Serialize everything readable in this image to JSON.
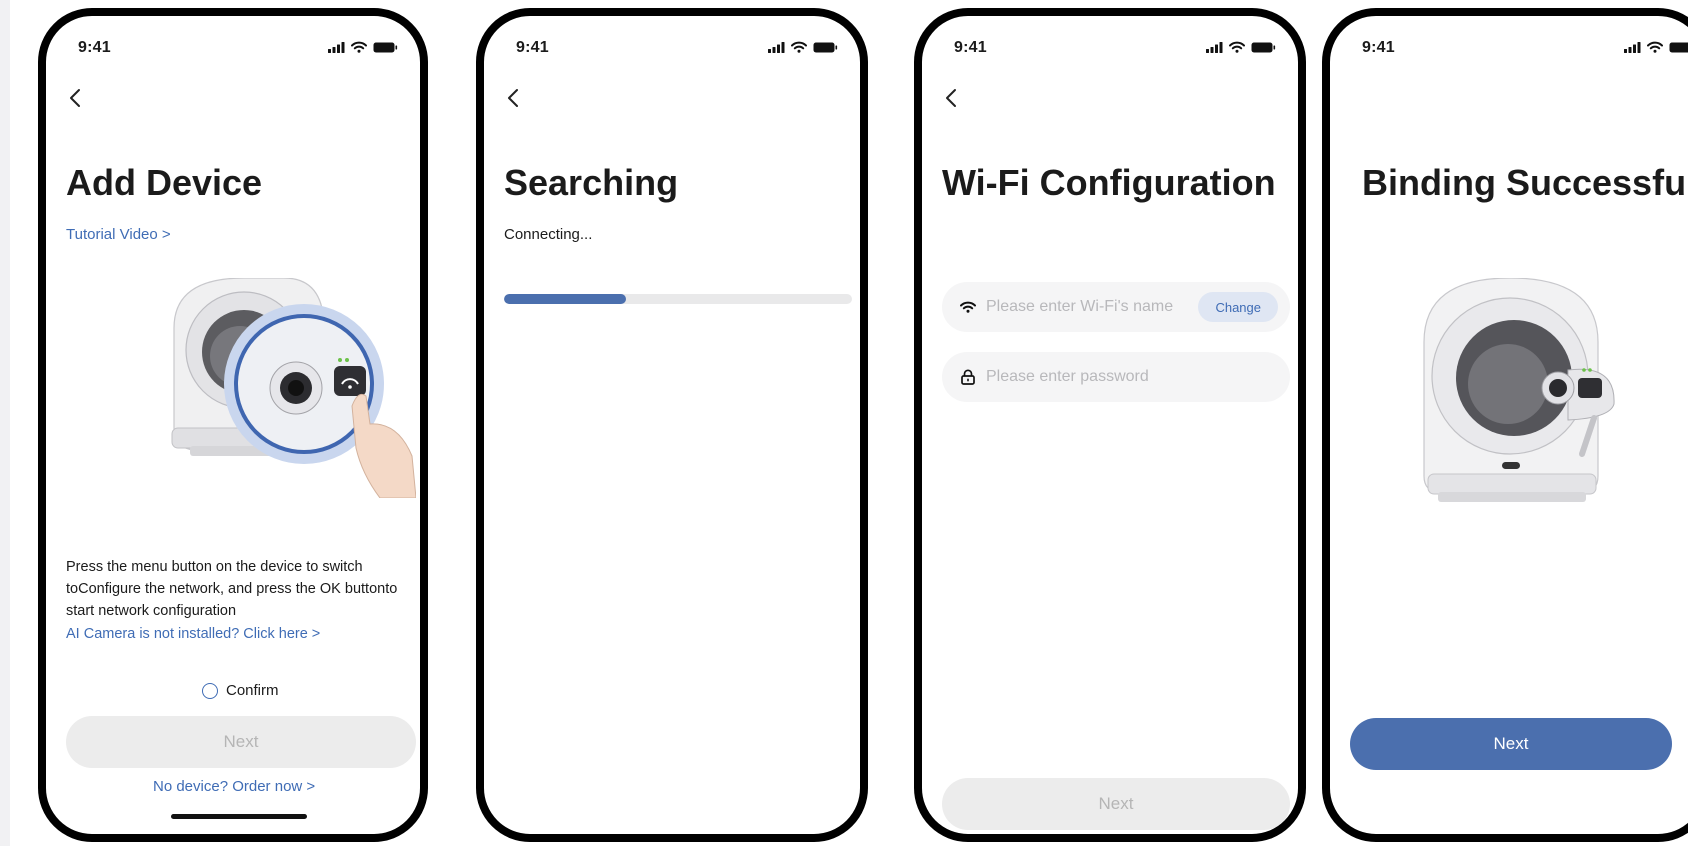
{
  "status_time": "9:41",
  "screens": {
    "add_device": {
      "title": "Add Device",
      "tutorial_link": "Tutorial Video >",
      "instructions": "Press the menu button on the device to switch toConfigure the network, and press the OK buttonto start network configuration",
      "camera_link": "AI Camera is not installed? Click here >",
      "confirm_label": "Confirm",
      "next_label": "Next",
      "order_link": "No device? Order now >"
    },
    "searching": {
      "title": "Searching",
      "status": "Connecting...",
      "progress": 0.35
    },
    "wifi_config": {
      "title": "Wi-Fi Configuration",
      "ssid_placeholder": "Please enter Wi-Fi's name",
      "change_label": "Change",
      "password_placeholder": "Please enter password",
      "next_label": "Next"
    },
    "binding": {
      "title": "Binding Successful",
      "next_label": "Next"
    }
  },
  "colors": {
    "accent": "#4b6fae",
    "link": "#3f6cb5",
    "disabled_bg": "#ececec",
    "disabled_text": "#b5b5b5",
    "field_bg": "#f5f5f6",
    "progress_track": "#e9e9ea"
  },
  "icons": [
    "back-chevron-icon",
    "signal-icon",
    "wifi-icon",
    "battery-icon",
    "lock-icon",
    "radio-icon"
  ]
}
